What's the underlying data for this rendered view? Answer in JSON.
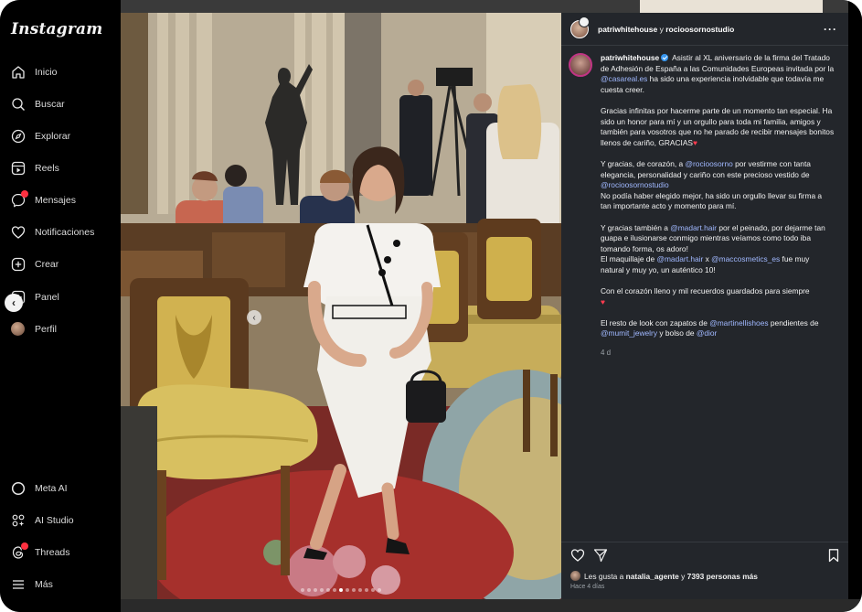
{
  "app": {
    "logo": "Instagram"
  },
  "sidebar": {
    "items": [
      {
        "label": "Inicio",
        "icon": "home-icon"
      },
      {
        "label": "Buscar",
        "icon": "search-icon"
      },
      {
        "label": "Explorar",
        "icon": "compass-icon"
      },
      {
        "label": "Reels",
        "icon": "reels-icon"
      },
      {
        "label": "Mensajes",
        "icon": "messenger-icon",
        "badge": true
      },
      {
        "label": "Notificaciones",
        "icon": "heart-icon"
      },
      {
        "label": "Crear",
        "icon": "plus-square-icon"
      },
      {
        "label": "Panel",
        "icon": "dashboard-icon"
      },
      {
        "label": "Perfil",
        "icon": "profile-avatar-icon"
      }
    ],
    "bottom_items": [
      {
        "label": "Meta AI",
        "icon": "meta-ai-icon"
      },
      {
        "label": "AI Studio",
        "icon": "ai-studio-icon"
      },
      {
        "label": "Threads",
        "icon": "threads-icon",
        "badge": true
      },
      {
        "label": "Más",
        "icon": "menu-icon"
      }
    ]
  },
  "post": {
    "header": {
      "author": "patriwhitehouse",
      "joiner": "y",
      "coauthor": "rocioosornostudio",
      "more": "···"
    },
    "caption": {
      "username": "patriwhitehouse",
      "p1": "Asistir al XL aniversario de la firma del Tratado de Adhesión de España a las Comunidades Europeas invitada por la",
      "p1_mention": "@casareal.es",
      "p1_tail": "ha sido una experiencia inolvidable que todavía me cuesta creer.",
      "p2": "Gracias infinitas por hacerme parte de un momento tan especial. Ha sido un honor para mí y un orgullo para toda mi familia, amigos y también para vosotros que no he parado de recibir mensajes bonitos llenos de cariño, GRACIAS",
      "p3_a": "Y gracias, de corazón, a",
      "p3_mention1": "@rocioosorno",
      "p3_b": "por vestirme con tanta elegancia, personalidad y cariño con este precioso vestido de",
      "p3_mention2": "@rocioosornostudio",
      "p3_c": "No podía haber elegido mejor, ha sido un orgullo llevar su firma a tan importante acto y momento para mí.",
      "p4_a": "Y gracias también a",
      "p4_mention1": "@madart.hair",
      "p4_b": "por el peinado, por dejarme tan guapa e ilusionarse conmigo mientras veíamos como todo iba tomando forma, os adoro!",
      "p4_c": "El maquillaje de",
      "p4_mention2": "@madart.hair",
      "p4_x": "x",
      "p4_mention3": "@maccosmetics_es",
      "p4_d": "fue muy natural y muy yo, un auténtico 10!",
      "p5": "Con el corazón lleno y mil recuerdos guardados para siempre",
      "p6_a": "El resto de look con zapatos de",
      "p6_mention1": "@martinellishoes",
      "p6_b": "pendientes de",
      "p6_mention2": "@mumit_jewelry",
      "p6_c": "y bolso de",
      "p6_mention3": "@dior",
      "time": "4 d"
    },
    "likes": {
      "prefix": "Les gusta a",
      "user": "natalia_agente",
      "middle": "y",
      "count": "7393 personas más"
    },
    "ago": "Hace 4 días",
    "carousel": {
      "total": 13,
      "active": 6
    }
  },
  "colors": {
    "panel_bg": "#23262b",
    "mention": "#a0b8ff",
    "badge": "#ff3040",
    "verified": "#3897f0"
  }
}
